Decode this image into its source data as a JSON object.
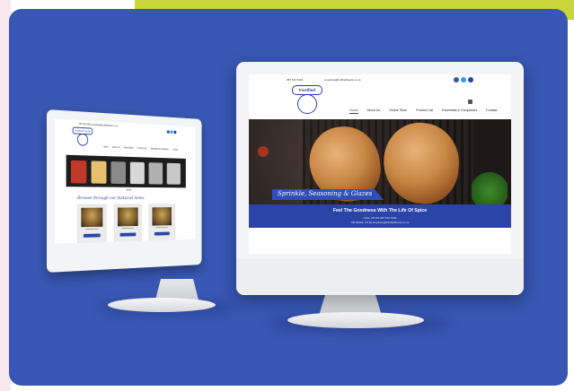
{
  "colors": {
    "background_blue": "#3857b4",
    "accent_lime": "#c8d63a",
    "brand_blue": "#2a44a8",
    "monitor_white": "#f3f4f6"
  },
  "right_monitor": {
    "topbar": {
      "phone": "087 813 5404",
      "email": "enquiries@fortifiedfoods.co.za"
    },
    "social_icons": [
      "facebook-icon",
      "twitter-icon",
      "instagram-icon"
    ],
    "logo_text": "Fortified Foods",
    "nav": [
      {
        "label": "Home",
        "active": true
      },
      {
        "label": "About Us",
        "active": false
      },
      {
        "label": "Online Store",
        "active": false
      },
      {
        "label": "Product List",
        "active": false
      },
      {
        "label": "Essentials & Companies",
        "active": false
      },
      {
        "label": "Contact",
        "active": false
      }
    ],
    "hero_tagline": "Sprinkle, Seasoning & Glazes",
    "headline": "Feel The Goodness With The Life Of Spice",
    "call_line": "CALL US ON 087 813 5404",
    "email_line": "OR EMAIL US @ enquiries@fortifiedfoods.co.za"
  },
  "left_monitor": {
    "topbar": "087 813 5404   enquiries@fortifiedfoods.co.za",
    "logo_text": "Fortified Foods",
    "nav": [
      "Home",
      "About Us",
      "Online Store",
      "Product List",
      "Essentials & Companies",
      "Contact"
    ],
    "featured_heading": "Browse through our featured items",
    "products": [
      {
        "label": "Fortified Foods Spice"
      },
      {
        "label": "Fortified Foods Spice"
      },
      {
        "label": "Fortified Foods Spice"
      }
    ]
  }
}
